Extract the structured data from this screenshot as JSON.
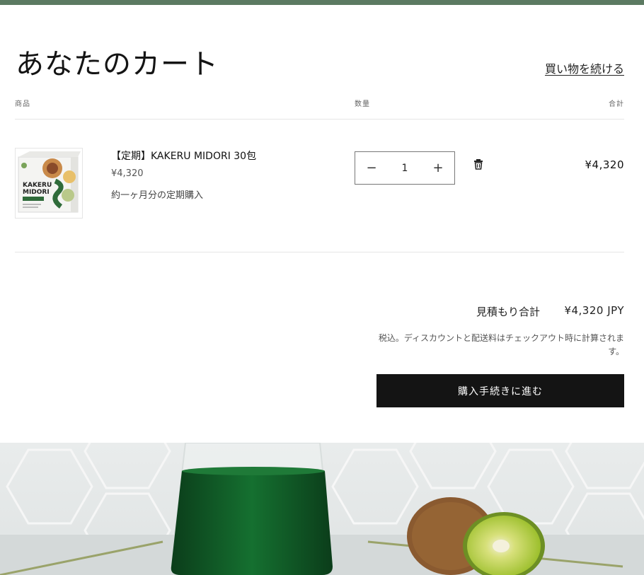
{
  "cart": {
    "title": "あなたのカート",
    "continue_label": "買い物を続ける",
    "columns": {
      "product": "商品",
      "quantity": "数量",
      "total": "合計"
    }
  },
  "item": {
    "image_alt": "KAKERU MIDORI",
    "image_logo_line1": "KAKERU",
    "image_logo_line2": "MIDORI",
    "title": "【定期】KAKERU MIDORI 30包",
    "price": "¥4,320",
    "note": "約一ヶ月分の定期購入",
    "quantity": "1",
    "decrease_symbol": "−",
    "increase_symbol": "+",
    "line_total": "¥4,320"
  },
  "summary": {
    "subtotal_label": "見積もり合計",
    "subtotal_value": "¥4,320 JPY",
    "tax_note": "税込。ディスカウントと配送料はチェックアウト時に計算されます。",
    "checkout_label": "購入手続きに進む"
  },
  "colors": {
    "topbar": "#5c7a62",
    "checkout_bg": "#141414",
    "drink_green": "#0f4d22",
    "kiwi_flesh": "#a9c636"
  },
  "icons": {
    "trash": "trash-icon",
    "minus": "minus-icon",
    "plus": "plus-icon"
  }
}
